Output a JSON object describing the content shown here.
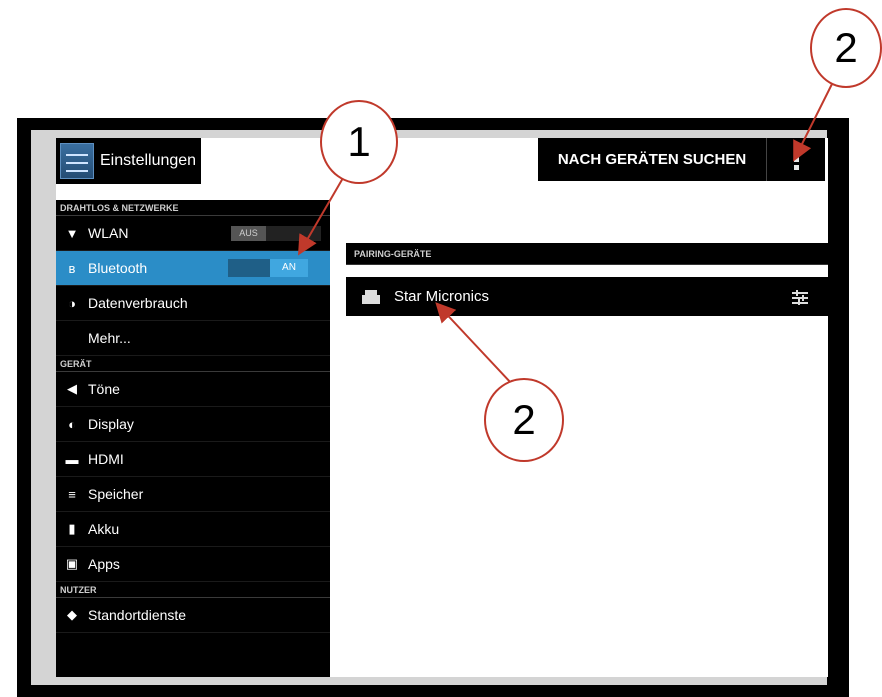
{
  "action_bar": {
    "title": "Einstellungen",
    "search_button": "NACH GERÄTEN SUCHEN",
    "overflow_icon": "more-vert-icon"
  },
  "sidebar": {
    "sections": [
      {
        "header": "DRAHTLOS & NETZWERKE",
        "items": [
          {
            "label": "WLAN",
            "icon": "wifi-icon",
            "toggle": "AUS"
          },
          {
            "label": "Bluetooth",
            "icon": "bluetooth-icon",
            "toggle": "AN",
            "selected": true
          },
          {
            "label": "Datenverbrauch",
            "icon": "data-usage-icon"
          },
          {
            "label": "Mehr...",
            "icon": ""
          }
        ]
      },
      {
        "header": "GERÄT",
        "items": [
          {
            "label": "Töne",
            "icon": "sound-icon"
          },
          {
            "label": "Display",
            "icon": "display-icon"
          },
          {
            "label": "HDMI",
            "icon": "hdmi-icon"
          },
          {
            "label": "Speicher",
            "icon": "storage-icon"
          },
          {
            "label": "Akku",
            "icon": "battery-icon"
          },
          {
            "label": "Apps",
            "icon": "apps-icon"
          }
        ]
      },
      {
        "header": "NUTZER",
        "items": [
          {
            "label": "Standortdienste",
            "icon": "location-icon"
          }
        ]
      }
    ]
  },
  "pairing": {
    "header": "PAIRING-GERÄTE",
    "device": "Star Micronics"
  },
  "callouts": {
    "c1": "1",
    "c2_top": "2",
    "c2_mid": "2"
  },
  "colors": {
    "selected": "#2b8dc7",
    "annotation": "#c0392b"
  }
}
